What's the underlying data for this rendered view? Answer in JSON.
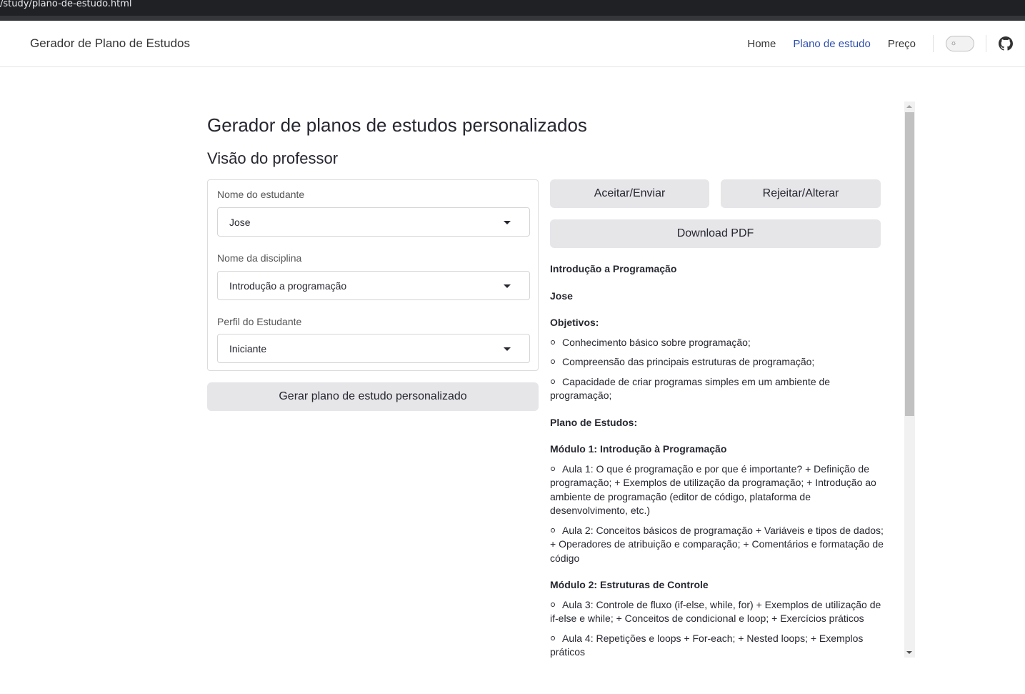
{
  "browser": {
    "url": "/study/plano-de-estudo.html"
  },
  "navbar": {
    "brand": "Gerador de Plano de Estudos",
    "links": [
      "Home",
      "Plano de estudo",
      "Preço"
    ],
    "active_link": "Plano de estudo",
    "theme_toggle_icon": "sun-icon",
    "repo_icon": "github-icon"
  },
  "main": {
    "title": "Gerador de planos de estudos personalizados",
    "subtitle": "Visão do professor",
    "form": {
      "student_label": "Nome do estudante",
      "student_value": "Jose",
      "subject_label": "Nome da disciplina",
      "subject_value": "Introdução a programação",
      "profile_label": "Perfil do Estudante",
      "profile_value": "Iniciante"
    },
    "generate_button": "Gerar plano de estudo personalizado",
    "accept_button": "Aceitar/Enviar",
    "reject_button": "Rejeitar/Alterar",
    "download_button": "Download PDF"
  },
  "plan": {
    "course": "Introdução a Programação",
    "student": "Jose",
    "objectives_title": "Objetivos:",
    "objectives": [
      "Conhecimento básico sobre programação;",
      "Compreensão das principais estruturas de programação;",
      "Capacidade de criar programas simples em um ambiente de programação;"
    ],
    "plan_title": "Plano de Estudos:",
    "module1_title": "Módulo 1: Introdução à Programação",
    "module1_items": [
      "Aula 1: O que é programação e por que é importante? + Definição de programação; + Exemplos de utilização da programação; + Introdução ao ambiente de programação (editor de código, plataforma de desenvolvimento, etc.)",
      "Aula 2: Conceitos básicos de programação + Variáveis e tipos de dados; + Operadores de atribuição e comparação; + Comentários e formatação de código"
    ],
    "module2_title": "Módulo 2: Estruturas de Controle",
    "module2_items": [
      "Aula 3: Controle de fluxo (if-else, while, for) + Exemplos de utilização de if-else e while; + Conceitos de condicional e loop; + Exercícios práticos",
      "Aula 4: Repetições e loops + For-each; + Nested loops; + Exemplos práticos"
    ]
  }
}
